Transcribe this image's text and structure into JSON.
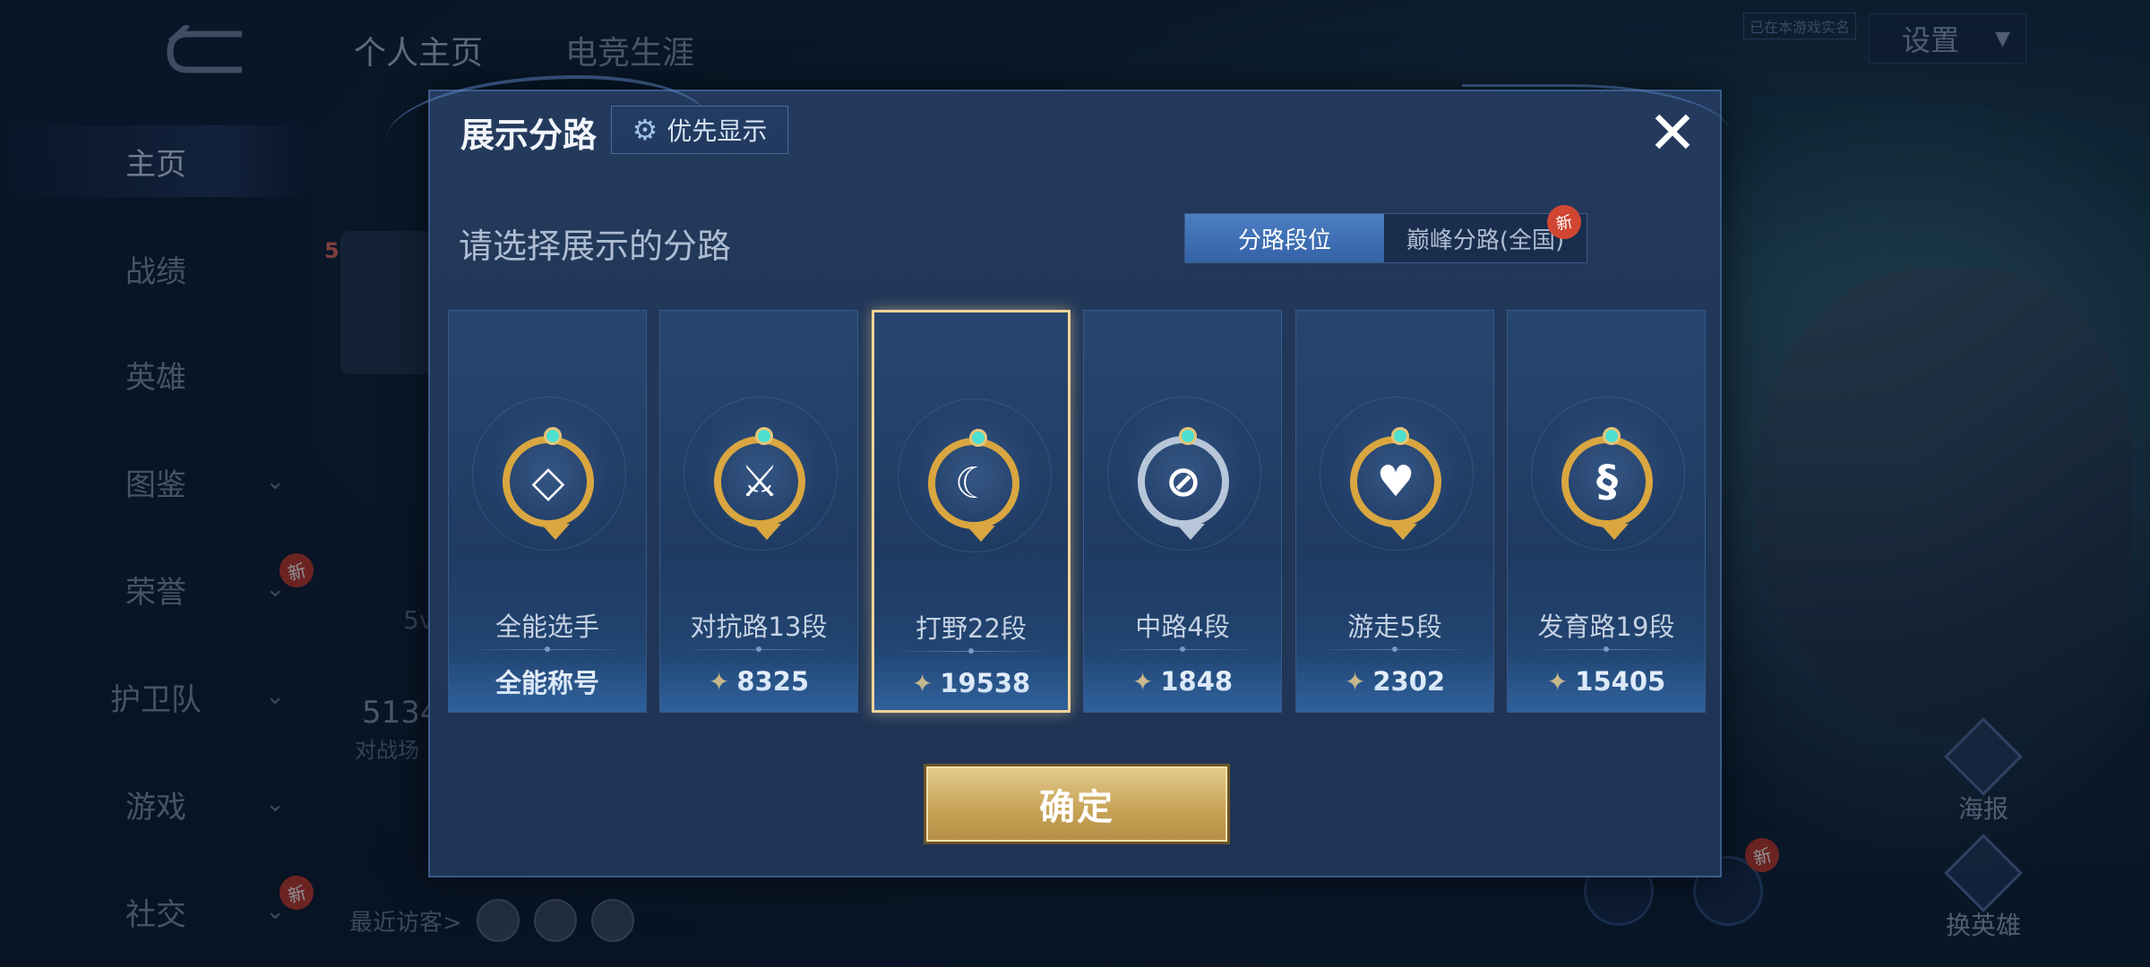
{
  "background": {
    "top_tabs": [
      "个人主页",
      "电竞生涯"
    ],
    "settings_label": "设置",
    "verify_tag": "已在本游戏实名",
    "nav_items": [
      {
        "label": "主页",
        "active": true,
        "has_chevron": false,
        "is_new": false
      },
      {
        "label": "战绩",
        "active": false,
        "has_chevron": false,
        "is_new": false
      },
      {
        "label": "英雄",
        "active": false,
        "has_chevron": false,
        "is_new": false
      },
      {
        "label": "图鉴",
        "active": false,
        "has_chevron": true,
        "is_new": false
      },
      {
        "label": "荣誉",
        "active": false,
        "has_chevron": true,
        "is_new": true
      },
      {
        "label": "护卫队",
        "active": false,
        "has_chevron": true,
        "is_new": false
      },
      {
        "label": "游戏",
        "active": false,
        "has_chevron": true,
        "is_new": false
      },
      {
        "label": "社交",
        "active": false,
        "has_chevron": true,
        "is_new": true
      }
    ],
    "new_badge_text": "新",
    "stats_number": "5134",
    "stats_label": "对战场",
    "partial_text": "5v",
    "rank_number": "5",
    "recent_visitors_label": "最近访客>",
    "right_buttons": [
      "海报",
      "换英雄"
    ]
  },
  "modal": {
    "title": "展示分路",
    "priority_button": "优先显示",
    "close_icon": "close-icon",
    "subtitle": "请选择展示的分路",
    "segments": [
      {
        "label": "分路段位",
        "active": true,
        "is_new": false
      },
      {
        "label": "巅峰分路(全国)",
        "active": false,
        "is_new": true
      }
    ],
    "new_badge_text": "新",
    "cards": [
      {
        "label": "全能选手",
        "value": "全能称号",
        "has_points_icon": false,
        "selected": false,
        "badge_style": "gold",
        "badge_glyph": "◇"
      },
      {
        "label": "对抗路13段",
        "value": "8325",
        "has_points_icon": true,
        "selected": false,
        "badge_style": "gold",
        "badge_glyph": "⚔"
      },
      {
        "label": "打野22段",
        "value": "19538",
        "has_points_icon": true,
        "selected": true,
        "badge_style": "gold",
        "badge_glyph": "☾"
      },
      {
        "label": "中路4段",
        "value": "1848",
        "has_points_icon": true,
        "selected": false,
        "badge_style": "silver",
        "badge_glyph": "⊘"
      },
      {
        "label": "游走5段",
        "value": "2302",
        "has_points_icon": true,
        "selected": false,
        "badge_style": "gold",
        "badge_glyph": "♥"
      },
      {
        "label": "发育路19段",
        "value": "15405",
        "has_points_icon": true,
        "selected": false,
        "badge_style": "gold",
        "badge_glyph": "§"
      }
    ],
    "confirm_button": "确定"
  },
  "colors": {
    "accent_blue": "#3463a6",
    "gold": "#d9a640",
    "selected_border": "#f1d398",
    "modal_bg": "#233a5c"
  }
}
